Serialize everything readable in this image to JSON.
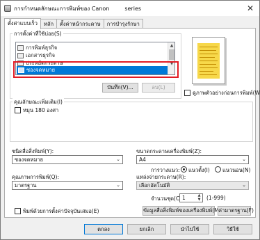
{
  "window": {
    "title": "การกำหนดลักษณะการพิมพ์ของ Canon",
    "title_suffix": "series",
    "close": "✕"
  },
  "tabs": [
    {
      "label": "ตั้งค่าแบบเร็ว",
      "active": true
    },
    {
      "label": "หลัก",
      "active": false
    },
    {
      "label": "ตั้งค่าหน้ากระดาษ",
      "active": false
    },
    {
      "label": "การบำรุงรักษา",
      "active": false
    }
  ],
  "common_settings": {
    "label": "การตั้งค่าที่ใช้บ่อย(S)",
    "items": [
      {
        "label": "การพิมพ์ธุรกิจ",
        "icon": "printer-icon",
        "selected": false
      },
      {
        "label": "เอกสารธุรกิจ",
        "icon": "document-icon",
        "selected": false
      },
      {
        "label": "ประหยัดกระดาษ",
        "icon": "paper-icon",
        "selected": false
      },
      {
        "label": "ซองจดหมาย",
        "icon": "envelope-icon",
        "selected": true
      }
    ],
    "save_button": "บันทึก(V)...",
    "delete_button": "ลบ(L)"
  },
  "always_print_current": "ดูภาพตัวอย่างก่อนการพิมพ์(W)",
  "additional_features": {
    "label": "คุณลักษณะเพิ่มเติม(I)",
    "rotate": "หมุน 180 องศา"
  },
  "media_type": {
    "label": "ชนิดสื่อสิ่งพิมพ์(Y):",
    "value": "ซองจดหมาย"
  },
  "printer_paper_size": {
    "label": "ขนาดกระดาษเครื่องพิมพ์(Z):",
    "value": "A4"
  },
  "orientation": {
    "label": "การวางแนว:",
    "portrait": "แนวตั้ง(I)",
    "landscape": "แนวนอน(N)",
    "selected": "portrait"
  },
  "print_quality": {
    "label": "คุณภาพการพิมพ์(Q):",
    "value": "มาตรฐาน"
  },
  "paper_source": {
    "label": "แหล่งจ่ายกระดาษ(R):",
    "value": "เลือกอัตโนมัติ"
  },
  "copies": {
    "label": "จำนวนชุด(C):",
    "value": "1",
    "range": "(1-999)"
  },
  "always_print_checkbox": "พิมพ์ด้วยการตั้งค่าปัจจุบันเสมอ(E)",
  "printer_media_info_button": "ข้อมูลสื่อสิ่งพิมพ์ของเครื่องพิมพ์(M)...",
  "defaults_button": "ค่ามาตรฐาน(F)",
  "footer": {
    "ok": "ตกลง",
    "cancel": "ยกเลิก",
    "apply": "นำไปใช้",
    "help": "วิธีใช้"
  },
  "colors": {
    "selection": "#0078d7",
    "highlight_box": "#e21b23",
    "preview_paper": "#f7d84a"
  }
}
